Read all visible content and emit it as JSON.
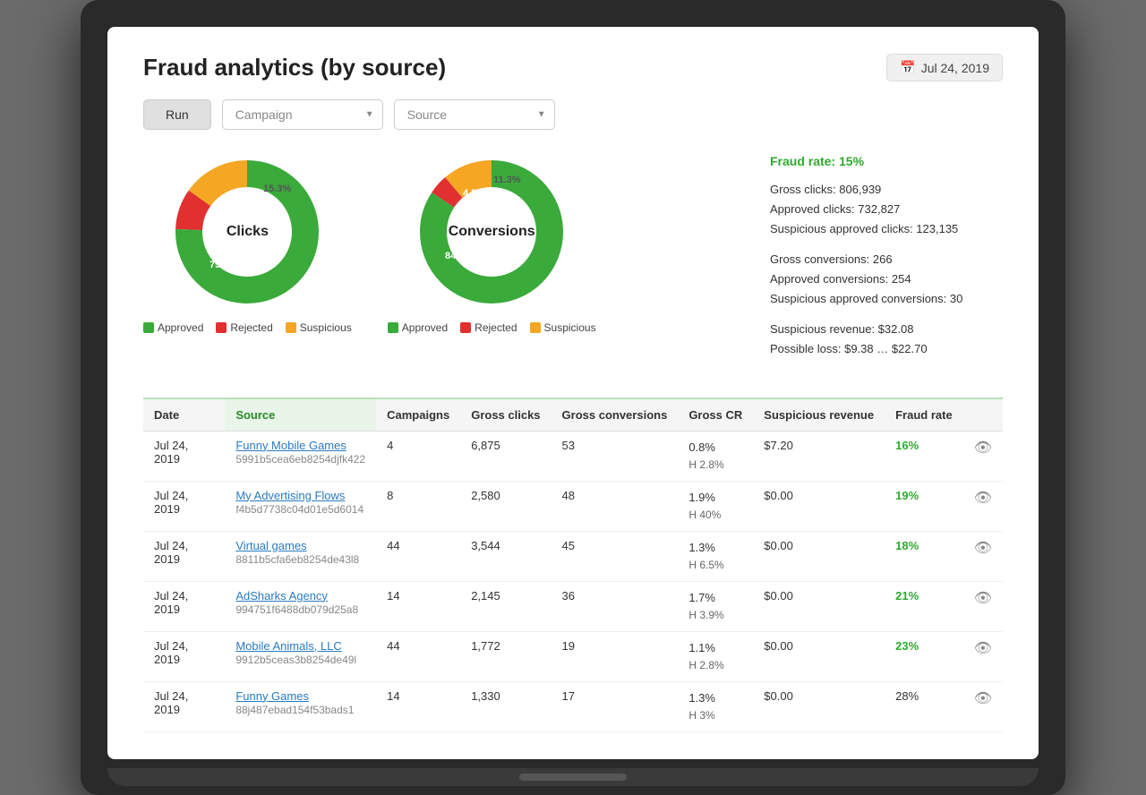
{
  "page": {
    "title": "Fraud analytics (by source)",
    "date": "Jul 24, 2019"
  },
  "controls": {
    "run_label": "Run",
    "campaign_placeholder": "Campaign",
    "source_placeholder": "Source"
  },
  "charts": {
    "clicks": {
      "label": "Clicks",
      "segments": [
        {
          "label": "Approved",
          "value": 75.6,
          "color": "#3aaa3a"
        },
        {
          "label": "Rejected",
          "value": 9.2,
          "color": "#e03030"
        },
        {
          "label": "Suspicious",
          "value": 15.3,
          "color": "#f5a623"
        }
      ],
      "legend": [
        {
          "label": "Approved",
          "color": "#3aaa3a"
        },
        {
          "label": "Rejected",
          "color": "#e03030"
        },
        {
          "label": "Suspicious",
          "color": "#f5a623"
        }
      ]
    },
    "conversions": {
      "label": "Conversions",
      "segments": [
        {
          "label": "Approved",
          "value": 84.2,
          "color": "#3aaa3a"
        },
        {
          "label": "Rejected",
          "value": 4.5,
          "color": "#e03030"
        },
        {
          "label": "Suspicious",
          "value": 11.3,
          "color": "#f5a623"
        }
      ],
      "legend": [
        {
          "label": "Approved",
          "color": "#3aaa3a"
        },
        {
          "label": "Rejected",
          "color": "#e03030"
        },
        {
          "label": "Suspicious",
          "color": "#f5a623"
        }
      ]
    }
  },
  "stats": {
    "fraud_rate_label": "Fraud rate: 15%",
    "lines": [
      "Gross clicks: 806,939",
      "Approved clicks: 732,827",
      "Suspicious approved clicks: 123,135",
      "",
      "Gross conversions: 266",
      "Approved conversions: 254",
      "Suspicious approved conversions: 30",
      "",
      "Suspicious revenue: $32.08",
      "Possible loss: $9.38 … $22.70"
    ]
  },
  "table": {
    "columns": [
      "Date",
      "Source",
      "Campaigns",
      "Gross clicks",
      "Gross conversions",
      "Gross CR",
      "Suspicious revenue",
      "Fraud rate",
      ""
    ],
    "rows": [
      {
        "date": "Jul 24, 2019",
        "source_name": "Funny Mobile Games",
        "source_id": "5991b5cea6eb8254djfk422",
        "campaigns": "4",
        "gross_clicks": "6,875",
        "gross_conversions": "53",
        "gross_cr": "0.8%\nH 2.8%",
        "suspicious_revenue": "$7.20",
        "fraud_rate": "16%",
        "fraud_rate_highlight": true
      },
      {
        "date": "Jul 24, 2019",
        "source_name": "My Advertising Flows",
        "source_id": "f4b5d7738c04d01e5d6014",
        "campaigns": "8",
        "gross_clicks": "2,580",
        "gross_conversions": "48",
        "gross_cr": "1.9%\nH 40%",
        "suspicious_revenue": "$0.00",
        "fraud_rate": "19%",
        "fraud_rate_highlight": true
      },
      {
        "date": "Jul 24, 2019",
        "source_name": "Virtual games",
        "source_id": "8811b5cfa6eb8254de43l8",
        "campaigns": "44",
        "gross_clicks": "3,544",
        "gross_conversions": "45",
        "gross_cr": "1.3%\nH 6.5%",
        "suspicious_revenue": "$0.00",
        "fraud_rate": "18%",
        "fraud_rate_highlight": true
      },
      {
        "date": "Jul 24, 2019",
        "source_name": "AdSharks Agency",
        "source_id": "994751f6488db079d25a8",
        "campaigns": "14",
        "gross_clicks": "2,145",
        "gross_conversions": "36",
        "gross_cr": "1.7%\nH 3.9%",
        "suspicious_revenue": "$0.00",
        "fraud_rate": "21%",
        "fraud_rate_highlight": true
      },
      {
        "date": "Jul 24, 2019",
        "source_name": "Mobile Animals, LLC",
        "source_id": "9912b5ceas3b8254de49l",
        "campaigns": "44",
        "gross_clicks": "1,772",
        "gross_conversions": "19",
        "gross_cr": "1.1%\nH 2.8%",
        "suspicious_revenue": "$0.00",
        "fraud_rate": "23%",
        "fraud_rate_highlight": true
      },
      {
        "date": "Jul 24, 2019",
        "source_name": "Funny Games",
        "source_id": "88j487ebad154f53bads1",
        "campaigns": "14",
        "gross_clicks": "1,330",
        "gross_conversions": "17",
        "gross_cr": "1.3%\nH 3%",
        "suspicious_revenue": "$0.00",
        "fraud_rate": "28%",
        "fraud_rate_highlight": false
      }
    ]
  }
}
